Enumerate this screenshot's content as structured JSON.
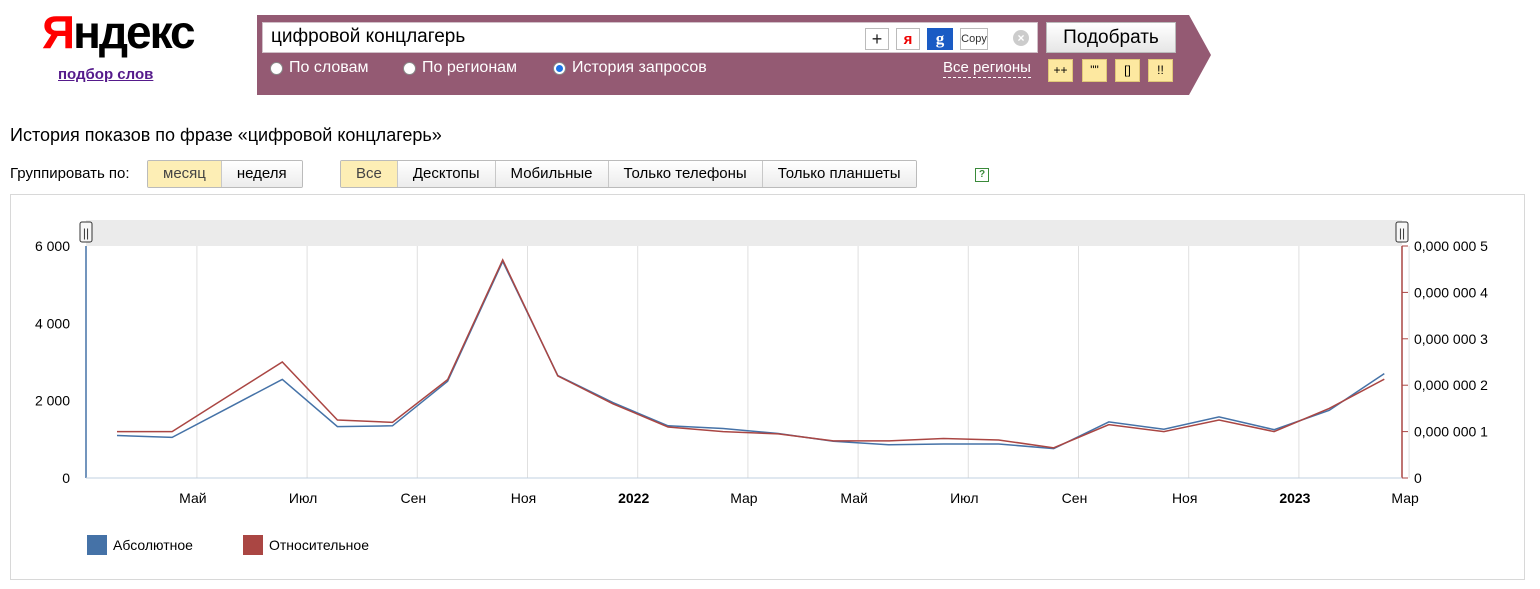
{
  "logo": {
    "ya": "Я",
    "rest": "ндекс"
  },
  "sublink": "подбор слов",
  "search": {
    "query": "цифровой концлагерь",
    "plus": "+",
    "ya": "я",
    "g": "g",
    "copy": "Copy",
    "clear": "×",
    "submit": "Подобрать"
  },
  "radios": [
    {
      "label": "По словам",
      "selected": false
    },
    {
      "label": "По регионам",
      "selected": false
    },
    {
      "label": "История запросов",
      "selected": true
    }
  ],
  "regions_link": "Все регионы",
  "operators": [
    "++",
    "\"\"",
    "[]",
    "!!"
  ],
  "page_title": "История показов по фразе «цифровой концлагерь»",
  "group": {
    "label": "Группировать по:",
    "period": [
      {
        "label": "месяц",
        "active": true
      },
      {
        "label": "неделя",
        "active": false
      }
    ],
    "devices": [
      {
        "label": "Все",
        "active": true
      },
      {
        "label": "Десктопы",
        "active": false
      },
      {
        "label": "Мобильные",
        "active": false
      },
      {
        "label": "Только телефоны",
        "active": false
      },
      {
        "label": "Только планшеты",
        "active": false
      }
    ],
    "help": "?"
  },
  "colors": {
    "absolute": "#4572a7",
    "relative": "#aa4643",
    "panel": "#945a73"
  },
  "chart_data": {
    "type": "line",
    "x": [
      "2021-04",
      "2021-05",
      "2021-06",
      "2021-07",
      "2021-08",
      "2021-09",
      "2021-10",
      "2021-11",
      "2021-12",
      "2022-01",
      "2022-02",
      "2022-03",
      "2022-04",
      "2022-05",
      "2022-06",
      "2022-07",
      "2022-08",
      "2022-09",
      "2022-10",
      "2022-11",
      "2022-12",
      "2023-01",
      "2023-02",
      "2023-03"
    ],
    "x_tick_labels": [
      {
        "x": "2021-05",
        "label": "Май",
        "bold": false
      },
      {
        "x": "2021-07",
        "label": "Июл",
        "bold": false
      },
      {
        "x": "2021-09",
        "label": "Сен",
        "bold": false
      },
      {
        "x": "2021-11",
        "label": "Ноя",
        "bold": false
      },
      {
        "x": "2022-01",
        "label": "2022",
        "bold": true
      },
      {
        "x": "2022-03",
        "label": "Мар",
        "bold": false
      },
      {
        "x": "2022-05",
        "label": "Май",
        "bold": false
      },
      {
        "x": "2022-07",
        "label": "Июл",
        "bold": false
      },
      {
        "x": "2022-09",
        "label": "Сен",
        "bold": false
      },
      {
        "x": "2022-11",
        "label": "Ноя",
        "bold": false
      },
      {
        "x": "2023-01",
        "label": "2023",
        "bold": true
      },
      {
        "x": "2023-03",
        "label": "Мар",
        "bold": false
      }
    ],
    "series": [
      {
        "name": "Абсолютное",
        "axis": "left",
        "values": [
          1100,
          1050,
          1800,
          2550,
          1330,
          1350,
          2500,
          5600,
          2650,
          1950,
          1350,
          1280,
          1150,
          950,
          860,
          880,
          880,
          760,
          1450,
          1260,
          1580,
          1250,
          1750,
          2700
        ]
      },
      {
        "name": "Относительное",
        "axis": "right",
        "values": [
          1e-06,
          1e-06,
          1.75e-06,
          2.5e-06,
          1.25e-06,
          1.2e-06,
          2.12e-06,
          4.7e-06,
          2.2e-06,
          1.6e-06,
          1.1e-06,
          1e-06,
          9.5e-07,
          8e-07,
          8e-07,
          8.5e-07,
          8.2e-07,
          6.5e-07,
          1.15e-06,
          1e-06,
          1.25e-06,
          1e-06,
          1.5e-06,
          2.13e-06
        ]
      }
    ],
    "y_left": {
      "ylim": [
        0,
        6000
      ],
      "ticks": [
        0,
        2000,
        4000,
        6000
      ],
      "tick_labels": [
        "0",
        "2 000",
        "4 000",
        "6 000"
      ]
    },
    "y_right": {
      "ylim": [
        0,
        5e-06
      ],
      "ticks": [
        0,
        1e-06,
        2e-06,
        3e-06,
        4e-06,
        5e-06
      ],
      "tick_labels": [
        "0",
        "0,000 000 1",
        "0,000 000 2",
        "0,000 000 3",
        "0,000 000 4",
        "0,000 000 5"
      ]
    },
    "grid": "vertical",
    "legend": "bottom-left",
    "navigator_handle": "||"
  }
}
